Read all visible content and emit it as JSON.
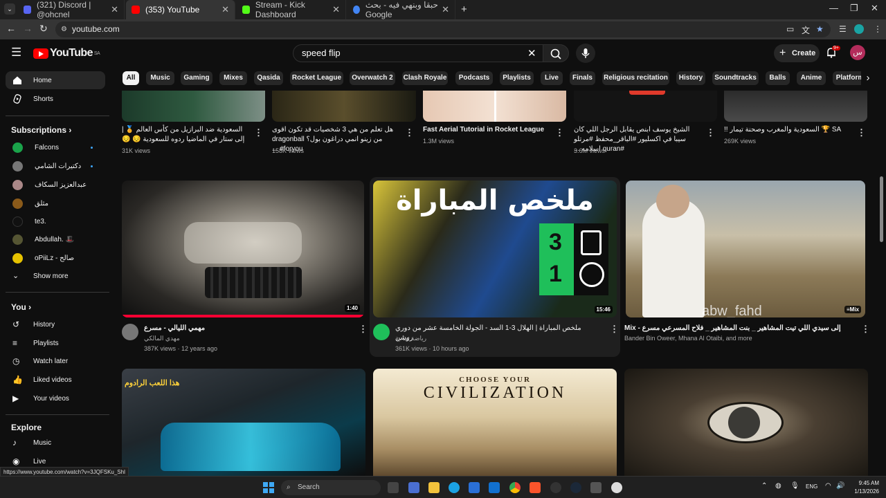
{
  "browser": {
    "tabs": [
      {
        "label": "(321) Discord | @ohcnel",
        "color": "#5865f2"
      },
      {
        "label": "(353) YouTube",
        "color": "#ff0000"
      },
      {
        "label": "Stream - Kick Dashboard",
        "color": "#53fc18"
      },
      {
        "label": "حبقا وبنهي فيه - بحث Google",
        "color": "#4285f4"
      }
    ],
    "url": "youtube.com"
  },
  "header": {
    "logo_text": "YouTube",
    "logo_region": "SA",
    "search_value": "speed flip",
    "create_label": "Create",
    "notif_count": "9+",
    "avatar_letter": "س"
  },
  "sidebar": {
    "main": [
      {
        "label": "Home",
        "icon": "home-icon"
      },
      {
        "label": "Shorts",
        "icon": "shorts-icon"
      }
    ],
    "subscriptions_title": "Subscriptions",
    "subscriptions": [
      {
        "label": "Falcons",
        "color": "#1aa34a",
        "dot": true
      },
      {
        "label": "دكتيرات الشامي",
        "color": "#777",
        "dot": true
      },
      {
        "label": "عبدالعزيز السكاف",
        "color": "#a88",
        "dot": false
      },
      {
        "label": "مثلق",
        "color": "#8a5a1a",
        "dot": false
      },
      {
        "label": "te3.",
        "color": "#111",
        "dot": false
      },
      {
        "label": "Abdullah. 🎩",
        "color": "#553",
        "dot": false
      },
      {
        "label": "oPiiLz - صالح",
        "color": "#e6c200",
        "dot": false
      }
    ],
    "show_more": "Show more",
    "you_title": "You",
    "you": [
      {
        "label": "History",
        "icon": "history-icon"
      },
      {
        "label": "Playlists",
        "icon": "playlists-icon"
      },
      {
        "label": "Watch later",
        "icon": "watch-later-icon"
      },
      {
        "label": "Liked videos",
        "icon": "liked-videos-icon"
      },
      {
        "label": "Your videos",
        "icon": "your-videos-icon"
      }
    ],
    "explore_title": "Explore",
    "explore": [
      {
        "label": "Music",
        "icon": "music-icon"
      },
      {
        "label": "Live",
        "icon": "live-icon"
      }
    ]
  },
  "chips": [
    "All",
    "Music",
    "Gaming",
    "Mixes",
    "Qasida",
    "Rocket League",
    "Overwatch 2",
    "Clash Royale",
    "Podcasts",
    "Playlists",
    "Live",
    "Finals",
    "Religious recitation",
    "History",
    "Soundtracks",
    "Balls",
    "Anime",
    "Platform"
  ],
  "top_row": [
    {
      "title": "السعودية ضد البرازيل من كأس العالم 🏅 | إلى ستار في الماضيا ردوه للسعودية 😔 😔",
      "meta": "31K views"
    },
    {
      "title": "هل تعلم من هي 3 شخصيات قد تكون اقوى من زينو انمي دراغون بول؟ dragonball #foryou ...",
      "meta": "158K views"
    },
    {
      "title": "Fast Aerial Tutorial in Rocket League",
      "meta": "1.3M views"
    },
    {
      "title": "الشيخ يوسف ابنص يقابل الرجل اللي كان سيبا في اكسليور #الباقر_محفظ #مرتلو #quran اسلامه ...",
      "meta": "3.6M views"
    },
    {
      "title": "SA 🏆 السعودية والمغرب وصحنة تيمار !!",
      "meta": "269K views"
    }
  ],
  "videos": [
    {
      "title": "مهمي الليالي - مسرع",
      "channel": "مهدي المالكي",
      "meta": "387K views · 12 years ago",
      "duration": "1:40"
    },
    {
      "title": "ملخص المباراة | الهلال 3-1 السد - الجولة الخامسة عشر من دوري روشن",
      "channel": "رياضة ثمانية",
      "meta": "361K views · 10 hours ago",
      "duration": "15:46",
      "overlay_title": "ملخص المباراة",
      "score_a": "3",
      "score_b": "1"
    },
    {
      "title": "Mix - إلى سيدي اللي تيت المشاهير _ بنت المشاهير _ فلاح المسرعي مسرع",
      "channel": "Bander Bin Oweer, Mhana Al Otaibi, and more",
      "meta": "",
      "duration": "Mix",
      "overlay_text": "abw_fahd"
    }
  ],
  "bottom_row": [
    {
      "overlay": "هذا اللعب الرادوم"
    },
    {
      "overlay_top": "CHOOSE YOUR",
      "overlay_main": "CIVILIZATION"
    },
    {
      "overlay": ""
    }
  ],
  "status_url": "https://www.youtube.com/watch?v=3JQFSKu_Shl",
  "taskbar": {
    "search": "Search",
    "lang": "ENG",
    "time": "9:45 AM",
    "date": "1/13/2026"
  },
  "colors": {
    "accent": "#ff0000",
    "bg": "#0f0f0f",
    "chip": "#272727",
    "link": "#3ea6ff"
  }
}
